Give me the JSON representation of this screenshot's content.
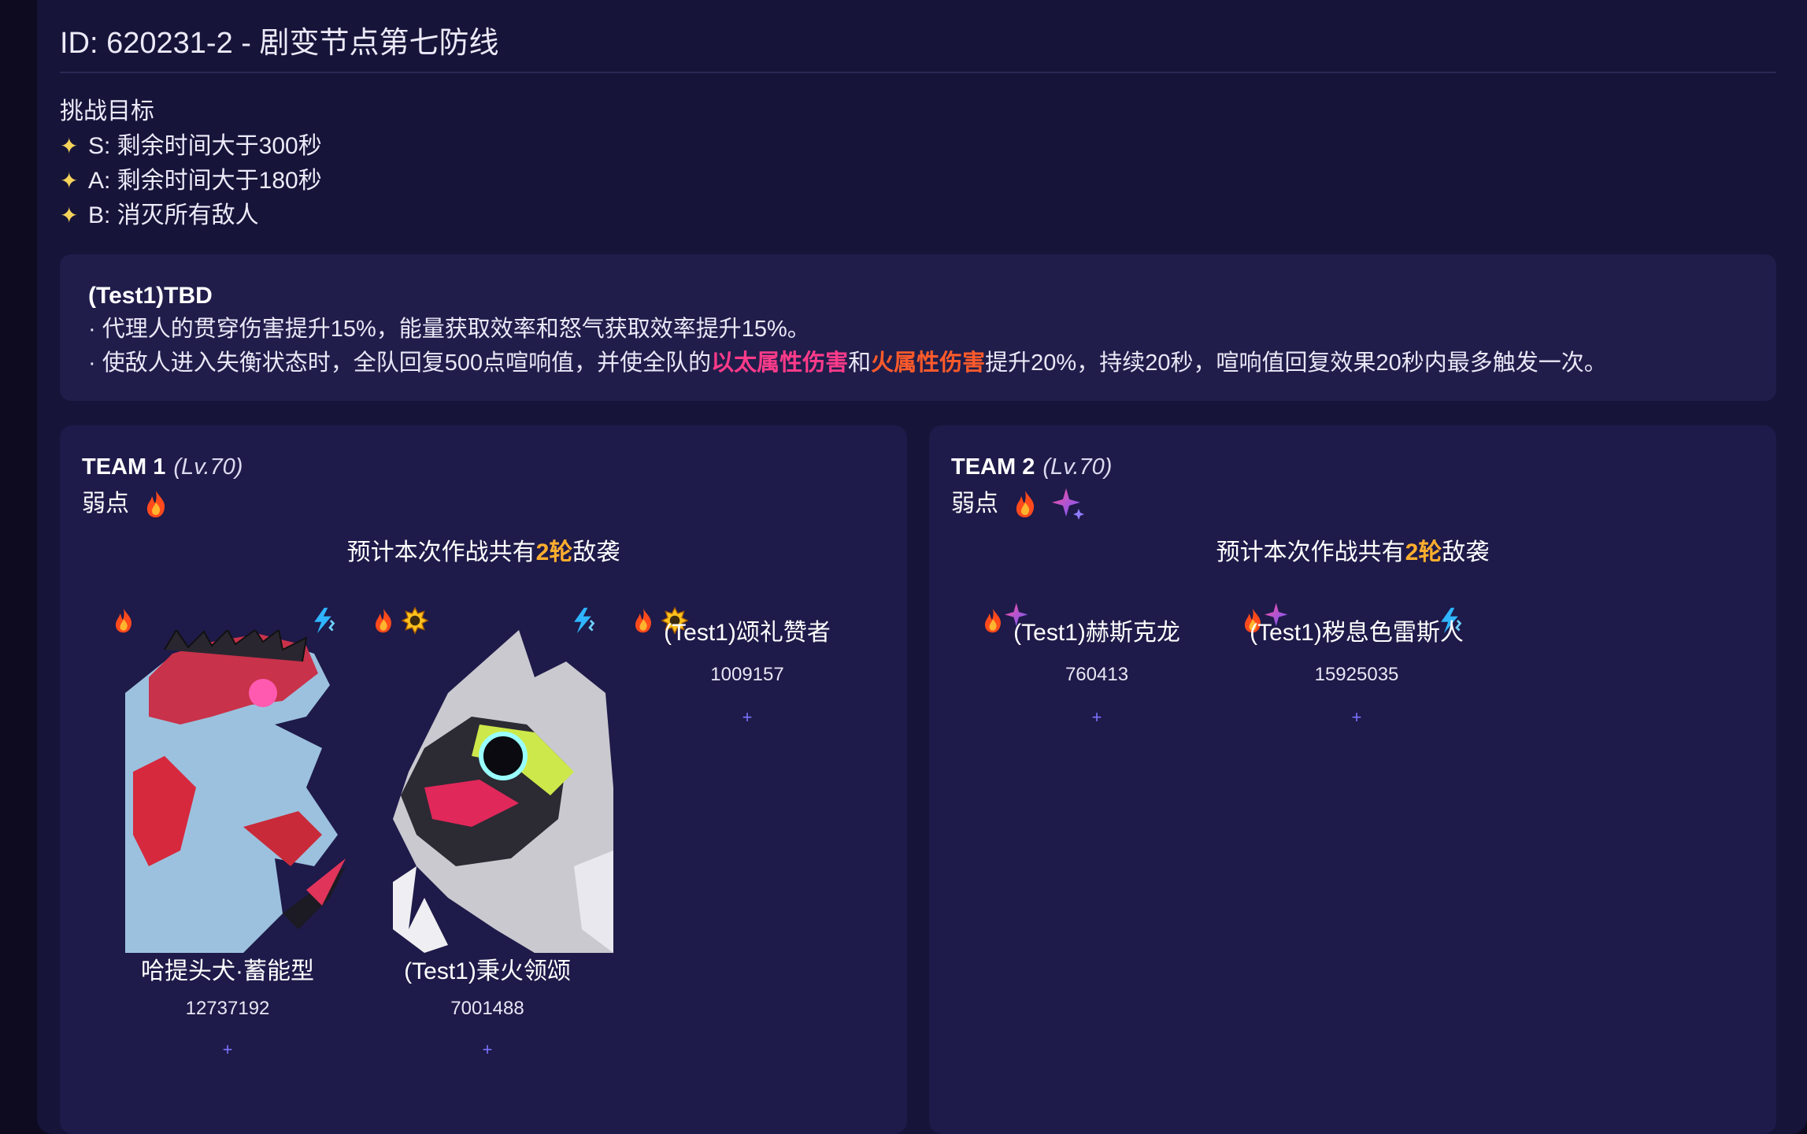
{
  "page": {
    "title": "ID: 620231-2 - 剧变节点第七防线"
  },
  "objectives": {
    "heading": "挑战目标",
    "items": [
      {
        "marker": "✦",
        "text": "S: 剩余时间大于300秒"
      },
      {
        "marker": "✦",
        "text": "A: 剩余时间大于180秒"
      },
      {
        "marker": "✦",
        "text": "B: 消灭所有敌人"
      }
    ]
  },
  "buff": {
    "title": "(Test1)TBD",
    "line1": "· 代理人的贯穿伤害提升15%，能量获取效率和怒气获取效率提升15%。",
    "line2_a": "· 使敌人进入失衡状态时，全队回复500点喧响值，并使全队的",
    "line2_ether": "以太属性伤害",
    "line2_b": "和",
    "line2_fire": "火属性伤害",
    "line2_c": "提升20%，持续20秒，喧响值回复效果20秒内最多触发一次。"
  },
  "colors": {
    "accent_ether": "#ff3b8a",
    "accent_fire": "#ff5a2a",
    "wave_highlight": "#ffae2e",
    "plus": "#7b73ff"
  },
  "teams": [
    {
      "name": "TEAM 1",
      "level": "(Lv.70)",
      "weak_label": "弱点",
      "weak_icons": [
        "fire-icon"
      ],
      "wave_pre": "预计本次作战共有",
      "wave_num": "2轮",
      "wave_post": "敌袭",
      "enemies": [
        {
          "name": "哈提头犬·蓄能型",
          "hp": "12737192",
          "plus": "+",
          "icons": [
            "fire-icon",
            "electric-icon"
          ]
        },
        {
          "name": "(Test1)秉火领颂",
          "hp": "7001488",
          "plus": "+",
          "icons": [
            "fire-icon",
            "sun-icon",
            "electric-icon"
          ]
        },
        {
          "name": "(Test1)颂礼赞者",
          "hp": "1009157",
          "plus": "+",
          "icons": [
            "fire-icon",
            "sun-icon"
          ]
        }
      ]
    },
    {
      "name": "TEAM 2",
      "level": "(Lv.70)",
      "weak_label": "弱点",
      "weak_icons": [
        "fire-icon",
        "ether-sparkle-icon"
      ],
      "wave_pre": "预计本次作战共有",
      "wave_num": "2轮",
      "wave_post": "敌袭",
      "enemies": [
        {
          "name": "(Test1)赫斯克龙",
          "hp": "760413",
          "plus": "+",
          "icons": [
            "fire-icon",
            "ether-sparkle-icon"
          ]
        },
        {
          "name": "(Test1)秽息色雷斯人",
          "hp": "15925035",
          "plus": "+",
          "icons": [
            "fire-icon",
            "ether-sparkle-icon",
            "electric-icon"
          ]
        }
      ]
    }
  ]
}
